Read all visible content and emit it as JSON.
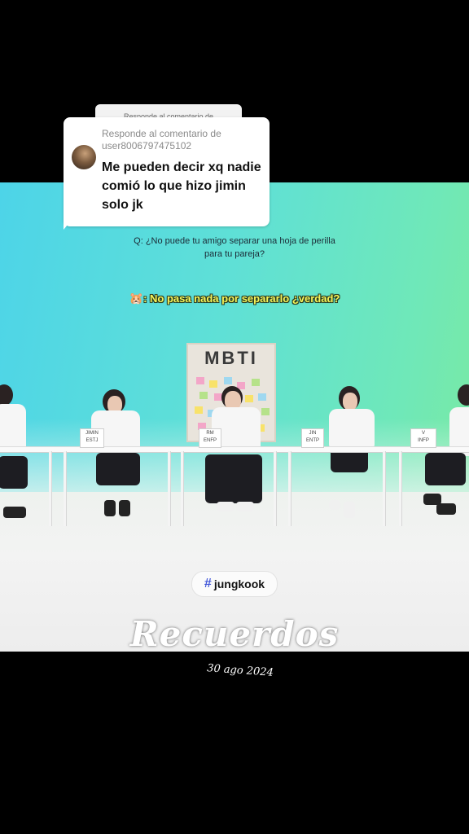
{
  "reply": {
    "behind_label": "Responde al comentario de",
    "label_line1": "Responde al comentario de",
    "label_line2": "user8006797475102",
    "comment": "Me pueden decir xq nadie comió lo que hizo jimin solo jk"
  },
  "video": {
    "question_line1": "Q: ¿No puede tu amigo separar una hoja de perilla",
    "question_line2": "para tu pareja?",
    "subtitle_emoji": "🐹",
    "subtitle_text": ": No pasa nada por separarlo ¿verdad?",
    "board_title": "MBTI",
    "nameplates": [
      {
        "line1": "JIMIN",
        "line2": "ESTJ"
      },
      {
        "line1": "RM",
        "line2": "ENFP"
      },
      {
        "line1": "JIN",
        "line2": "ENTP"
      },
      {
        "line1": "V",
        "line2": "INFP"
      }
    ],
    "hashtag": {
      "icon": "#",
      "text": "jungkook"
    }
  },
  "overlay": {
    "title": "Recuerdos",
    "date": "30 ago 2024"
  },
  "colors": {
    "subtitle": "#f6f55a",
    "hashtag_icon": "#4257d9",
    "background_top": "#4dd4e8",
    "background_right": "#7cea9e"
  }
}
